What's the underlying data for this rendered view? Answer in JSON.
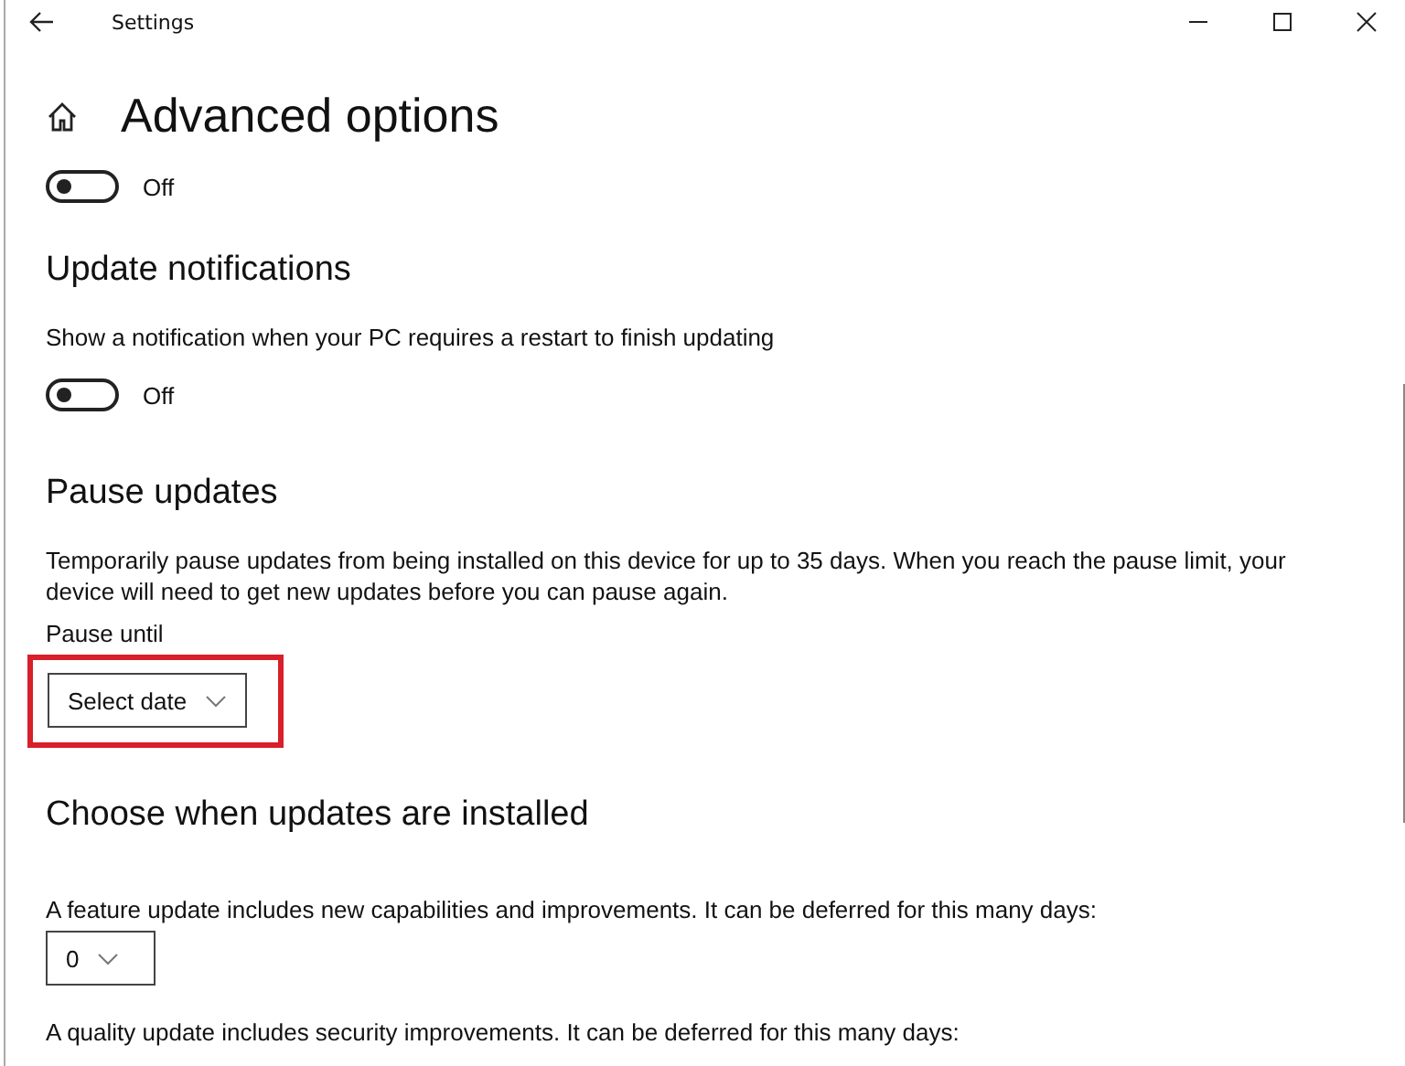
{
  "window": {
    "title": "Settings"
  },
  "page": {
    "title": "Advanced options"
  },
  "sections": [
    {
      "kind": "toggle",
      "on": false,
      "state_label": "Off"
    },
    {
      "kind": "toggle",
      "heading": "Update notifications",
      "description": "Show a notification when your PC requires a restart to finish updating",
      "on": false,
      "state_label": "Off"
    },
    {
      "kind": "dropdown",
      "heading": "Pause updates",
      "description": "Temporarily pause updates from being installed on this device for up to 35 days. When you reach the pause limit, your device will need to get new updates before you can pause again.",
      "label": "Pause until",
      "value": "Select date",
      "highlighted": true
    },
    {
      "kind": "dropdown",
      "heading": "Choose when updates are installed",
      "description": "A feature update includes new capabilities and improvements. It can be deferred for this many days:",
      "value": "0",
      "highlighted": false
    },
    {
      "kind": "text",
      "description": "A quality update includes security improvements. It can be deferred for this many days:"
    }
  ]
}
